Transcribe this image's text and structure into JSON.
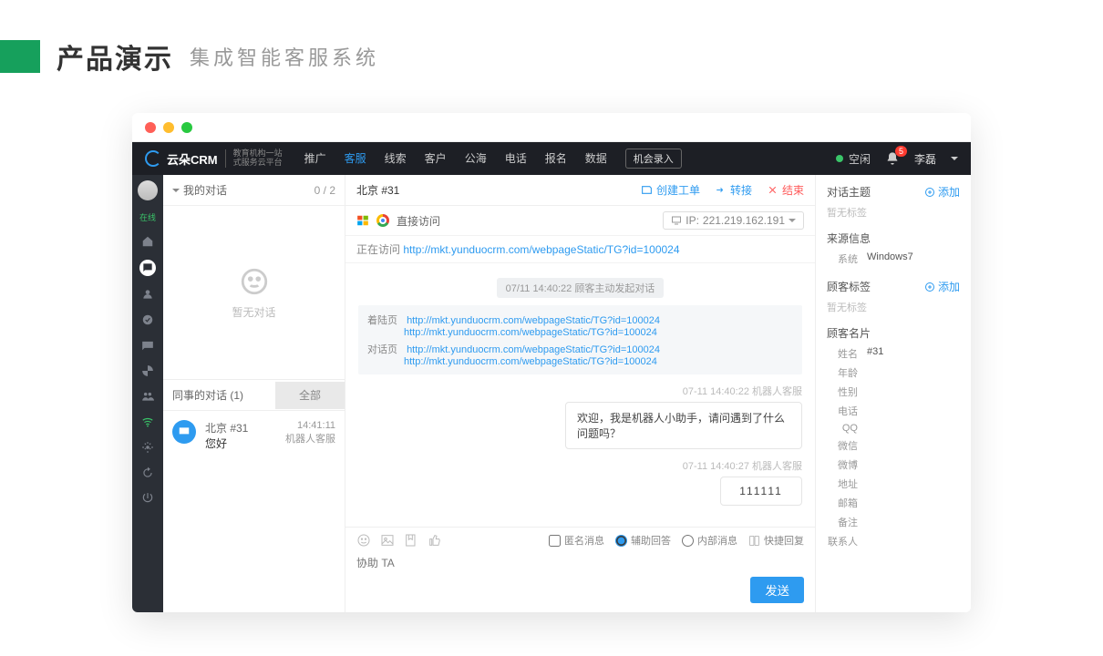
{
  "slide": {
    "title": "产品演示",
    "subtitle": "集成智能客服系统"
  },
  "logo": {
    "brand": "云朵CRM",
    "sub1": "教育机构一站",
    "sub2": "式服务云平台"
  },
  "nav": {
    "items": [
      "推广",
      "客服",
      "线索",
      "客户",
      "公海",
      "电话",
      "报名",
      "数据"
    ],
    "activeIndex": 1,
    "record": "机会录入"
  },
  "status": {
    "idle": "空闲",
    "badge": "5",
    "user": "李磊"
  },
  "rail": {
    "online": "在线"
  },
  "convoList": {
    "myHeader": "我的对话",
    "myCount": "0 / 2",
    "empty": "暂无对话",
    "colleagueHeader": "同事的对话  (1)",
    "allBtn": "全部",
    "item": {
      "title": "北京  #31",
      "preview": "您好",
      "time": "14:41:11",
      "agent": "机器人客服"
    }
  },
  "chat": {
    "title": "北京 #31",
    "actions": {
      "create": "创建工单",
      "transfer": "转接",
      "end": "结束"
    },
    "direct": "直接访问",
    "ipLabel": "IP:",
    "ip": "221.219.162.191",
    "visiting": "正在访问",
    "visitUrl": "http://mkt.yunduocrm.com/webpageStatic/TG?id=100024",
    "sysPill": "07/11 14:40:22  顾客主动发起对话",
    "landingLabel": "着陆页",
    "dialogLabel": "对话页",
    "url": "http://mkt.yunduocrm.com/webpageStatic/TG?id=100024",
    "meta1": "07-11 14:40:22  机器人客服",
    "bubble1": "欢迎，我是机器人小助手，请问遇到了什么问题吗？",
    "meta2": "07-11 14:40:27  机器人客服",
    "bubble2": "111111",
    "opts": {
      "anon": "匿名消息",
      "assist": "辅助回答",
      "internal": "内部消息",
      "quick": "快捷回复"
    },
    "placeholder": "协助 TA",
    "send": "发送"
  },
  "side": {
    "topic": "对话主题",
    "add": "添加",
    "noTag": "暂无标签",
    "source": "来源信息",
    "sysLabel": "系统",
    "sysVal": "Windows7",
    "custTag": "顾客标签",
    "card": "顾客名片",
    "fields": {
      "name": "姓名",
      "nameVal": "#31",
      "age": "年龄",
      "gender": "性别",
      "phone": "电话",
      "qq": "QQ",
      "wechat": "微信",
      "weibo": "微博",
      "addr": "地址",
      "email": "邮箱",
      "note": "备注",
      "contact": "联系人"
    }
  }
}
